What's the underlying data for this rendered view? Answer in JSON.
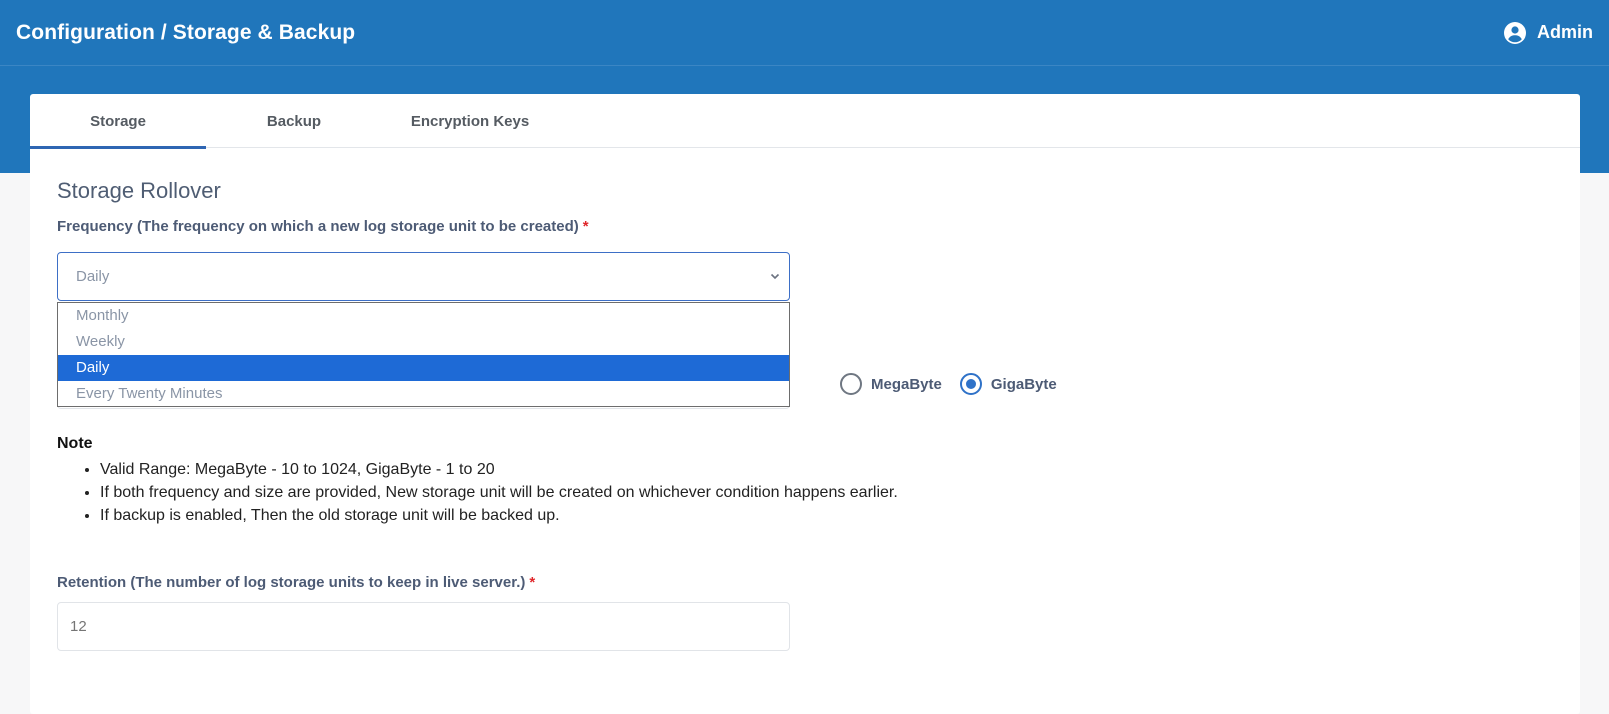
{
  "header": {
    "title": "Configuration / Storage & Backup",
    "user_label": "Admin",
    "user_icon": "account-circle-icon"
  },
  "tabs": [
    {
      "label": "Storage",
      "active": true
    },
    {
      "label": "Backup",
      "active": false
    },
    {
      "label": "Encryption Keys",
      "active": false
    }
  ],
  "storage": {
    "section_title": "Storage Rollover",
    "frequency": {
      "label": "Frequency (The frequency on which a new log storage unit to be created)",
      "required_mark": "*",
      "value": "Daily",
      "options": [
        "Monthly",
        "Weekly",
        "Daily",
        "Every Twenty Minutes"
      ],
      "selected_index": 2
    },
    "size_unit": {
      "options": [
        "MegaByte",
        "GigaByte"
      ],
      "selected": "GigaByte"
    },
    "note": {
      "title": "Note",
      "items": [
        "Valid Range: MegaByte - 10 to 1024, GigaByte - 1 to 20",
        "If both frequency and size are provided, New storage unit will be created on whichever condition happens earlier.",
        "If backup is enabled, Then the old storage unit will be backed up."
      ]
    },
    "retention": {
      "label": "Retention (The number of log storage units to keep in live server.)",
      "required_mark": "*",
      "placeholder": "12"
    }
  },
  "colors": {
    "header_bg": "#2076bb",
    "tab_active_indicator": "#2f66b3",
    "selected_option_bg": "#1e6ad6",
    "required": "#e0262a"
  }
}
